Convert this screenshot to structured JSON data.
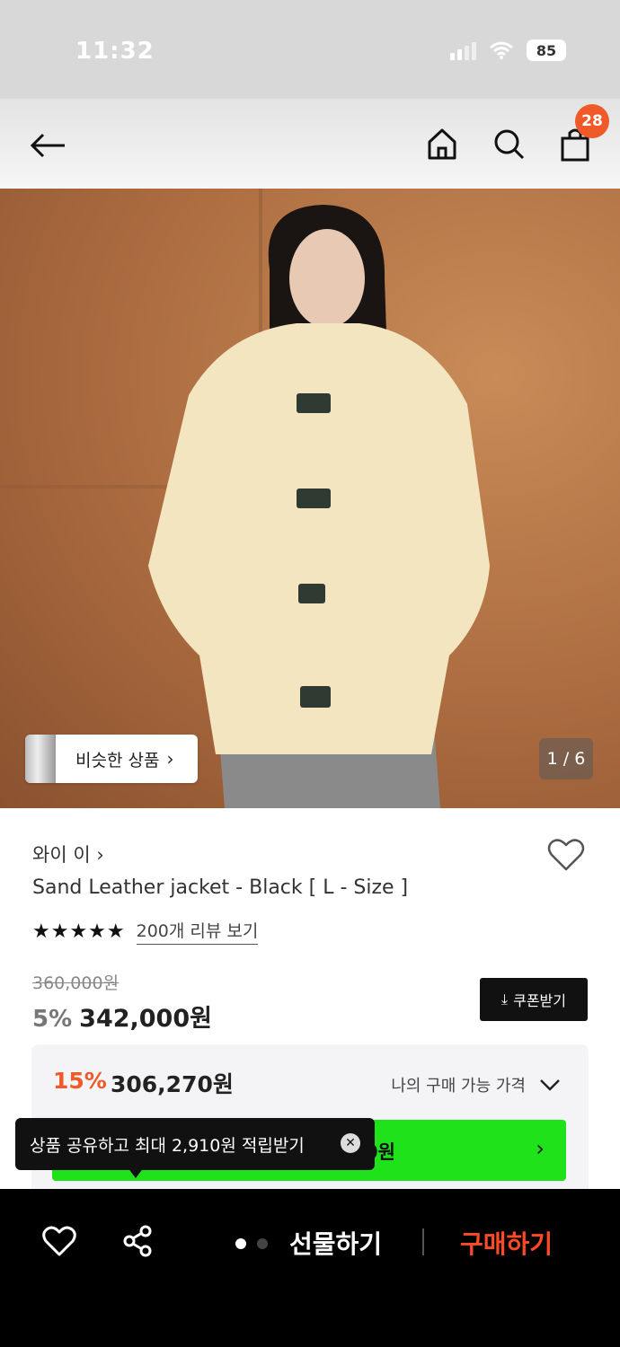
{
  "status_bar": {
    "time": "11:32",
    "battery": "85"
  },
  "nav": {
    "cart_count": "28"
  },
  "hero": {
    "similar_label": "비슷한 상품",
    "page_indicator": "1 / 6"
  },
  "product": {
    "brand": "와이 이",
    "title": "Sand Leather jacket - Black [ L - Size ]",
    "rating": 4.5,
    "stars": "★★★★★",
    "review_link": "200개 리뷰 보기",
    "original_price": "360,000원",
    "discount": "5%",
    "price": "342,000원",
    "coupon_label": "쿠폰받기"
  },
  "best_price": {
    "discount": "15%",
    "price": "306,270원",
    "label": "나의 구매 가능 가격",
    "green_partial_text": "0원"
  },
  "tooltip": {
    "text": "상품 공유하고 최대 2,910원 적립받기"
  },
  "bottom_bar": {
    "gift_label": "선물하기",
    "buy_label": "구매하기"
  },
  "colors": {
    "accent": "#f05a28",
    "buy": "#ff4a26",
    "green": "#1fe21b"
  }
}
